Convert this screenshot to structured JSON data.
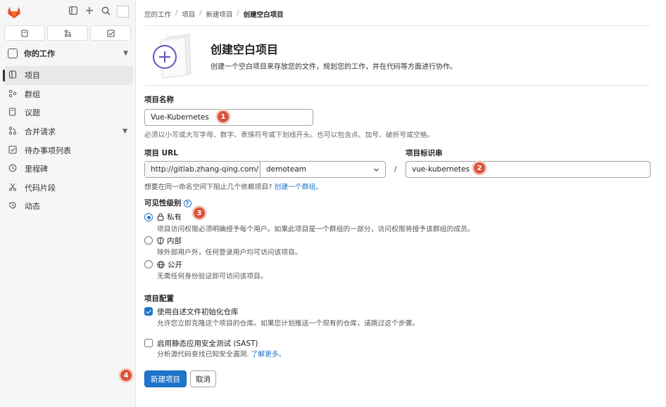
{
  "sidebar": {
    "tabs": [
      {
        "icon": "issues-icon"
      },
      {
        "icon": "merge-request-icon"
      },
      {
        "icon": "todo-icon"
      }
    ],
    "section_title": "你的工作",
    "items": [
      {
        "label": "项目",
        "icon": "project-icon",
        "active": true
      },
      {
        "label": "群组",
        "icon": "group-icon"
      },
      {
        "label": "议题",
        "icon": "issues-icon"
      },
      {
        "label": "合并请求",
        "icon": "merge-request-icon"
      },
      {
        "label": "待办事项列表",
        "icon": "todo-icon"
      },
      {
        "label": "里程碑",
        "icon": "clock-icon"
      },
      {
        "label": "代码片段",
        "icon": "snippet-icon"
      },
      {
        "label": "动态",
        "icon": "history-icon"
      }
    ]
  },
  "breadcrumb": [
    "您的工作",
    "项目",
    "新建项目",
    "创建空白项目"
  ],
  "header": {
    "title": "创建空白项目",
    "description": "创建一个空白项目来存放您的文件，规划您的工作，并在代码等方面进行协作。"
  },
  "form": {
    "project_name_label": "项目名称",
    "project_name_value": "Vue-Kubernetes",
    "project_name_help": "必须以小写或大写字母、数字、表情符号或下划线开头。也可以包含点、加号、破折号或空格。",
    "project_url_label": "项目 URL",
    "url_prefix": "http://gitlab.zhang-qing.com/",
    "namespace": "demoteam",
    "slash": "/",
    "slug_label": "项目标识串",
    "slug_value": "vue-kubernetes",
    "group_hint": "想要在同一命名空间下阻止几个依赖项目?",
    "group_hint_link": "创建一个群组。",
    "visibility_label": "可见性级别",
    "visibility_options": [
      {
        "label": "私有",
        "desc": "项目访问权限必须明确授予每个用户。如果此项目是一个群组的一部分，访问权限将授予该群组的成员。",
        "selected": true,
        "icon": "lock-icon"
      },
      {
        "label": "内部",
        "desc": "除外部用户外，任何登录用户均可访问该项目。",
        "selected": false,
        "icon": "shield-icon"
      },
      {
        "label": "公开",
        "desc": "无需任何身份验证即可访问该项目。",
        "selected": false,
        "icon": "globe-icon"
      }
    ],
    "config_label": "项目配置",
    "readme_label": "使用自述文件初始化仓库",
    "readme_desc": "允许您立即克隆这个项目的仓库。如果您计划推送一个现有的仓库，请跳过这个步骤。",
    "readme_checked": true,
    "sast_label": "启用静态应用安全测试 (SAST)",
    "sast_desc": "分析源代码查找已知安全漏洞.",
    "sast_link": "了解更多。",
    "sast_checked": false,
    "create_button": "新建项目",
    "cancel_button": "取消"
  },
  "badges": [
    "1",
    "2",
    "3",
    "4"
  ],
  "colors": {
    "primary": "#1f75cb",
    "badge": "#d9553b",
    "gitlab_orange": "#e24329",
    "illustration": "#6b4fbb"
  }
}
